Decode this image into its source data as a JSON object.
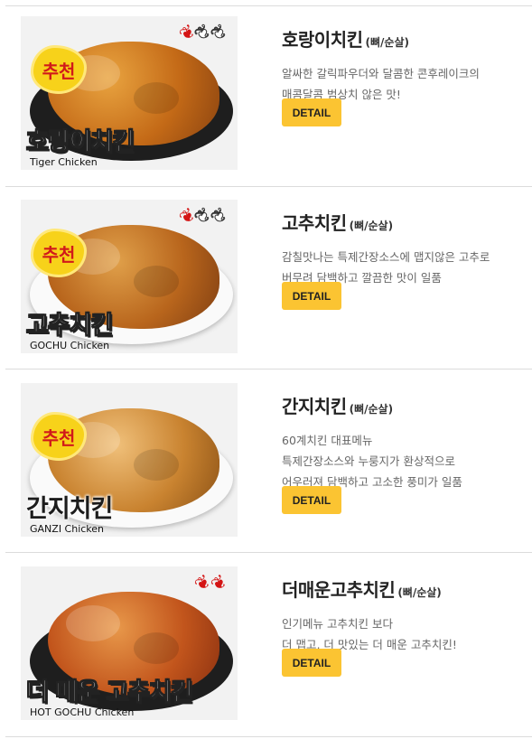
{
  "menu": [
    {
      "name": "호랑이치킨",
      "option": "(뼈/순살)",
      "description": [
        "알싸한 갈릭파우더와 달콤한 콘후레이크의",
        "매콤달콤 범상치 않은 맛!"
      ],
      "button": "DETAIL",
      "thumb_title": "호랑이치킨",
      "thumb_subtitle": "Tiger Chicken",
      "badge": "추천",
      "spice_level": 1,
      "spice_max": 3
    },
    {
      "name": "고추치킨",
      "option": "(뼈/순살)",
      "description": [
        "감칠맛나는 특제간장소스에 맵지않은 고추로",
        "버무려 담백하고 깔끔한 맛이 일품"
      ],
      "button": "DETAIL",
      "thumb_title": "고추치킨",
      "thumb_subtitle": "GOCHU Chicken",
      "badge": "추천",
      "spice_level": 1,
      "spice_max": 3
    },
    {
      "name": "간지치킨",
      "option": "(뼈/순살)",
      "description": [
        "60계치킨 대표메뉴",
        "특제간장소스와 누룽지가 환상적으로",
        "어우러져 담백하고 고소한 풍미가 일품"
      ],
      "button": "DETAIL",
      "thumb_title": "간지치킨",
      "thumb_subtitle": "GANZI Chicken",
      "badge": "추천",
      "spice_level": 0,
      "spice_max": 0
    },
    {
      "name": "더매운고추치킨",
      "option": "(뼈/순살)",
      "description": [
        "인기메뉴 고추치킨 보다",
        "더 맵고, 더 맛있는 더 매운 고추치킨!"
      ],
      "button": "DETAIL",
      "thumb_title": "더 매운 고추치킨",
      "thumb_subtitle": "HOT GOCHU Chicken",
      "badge": "",
      "spice_level": 2,
      "spice_max": 2
    }
  ],
  "colors": {
    "button_bg": "#fbc432",
    "badge_bg": "#f7d21a",
    "badge_text": "#d11a1a",
    "pepper_red": "#d41414"
  },
  "icons": {
    "pepper": "chili-pepper-icon"
  }
}
